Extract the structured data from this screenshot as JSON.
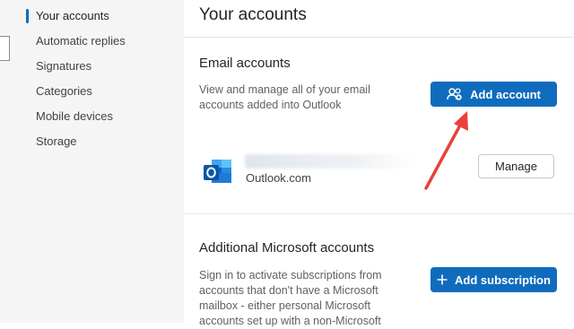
{
  "nav": {
    "items": [
      {
        "label": "Your accounts",
        "active": true
      },
      {
        "label": "Automatic replies",
        "active": false
      },
      {
        "label": "Signatures",
        "active": false
      },
      {
        "label": "Categories",
        "active": false
      },
      {
        "label": "Mobile devices",
        "active": false
      },
      {
        "label": "Storage",
        "active": false
      }
    ]
  },
  "main": {
    "title": "Your accounts",
    "email_accounts": {
      "heading": "Email accounts",
      "description_line1": "View and manage all of your email",
      "description_line2": "accounts added into Outlook",
      "add_button_label": "Add account",
      "add_button_icon": "add-person-icon",
      "account": {
        "icon": "outlook-logo-icon",
        "domain": "Outlook.com",
        "manage_label": "Manage"
      }
    },
    "additional_accounts": {
      "heading": "Additional Microsoft accounts",
      "description_line1": "Sign in to activate subscriptions from",
      "description_line2": "accounts that don't have a Microsoft",
      "description_line3": "mailbox - either personal Microsoft",
      "description_line4": "accounts set up with a non-Microsoft",
      "add_button_label": "Add subscription",
      "add_button_icon": "plus-icon"
    }
  },
  "colors": {
    "accent": "#0f6cbd",
    "annotation_arrow": "#e8413a",
    "nav_background": "#f5f5f5"
  }
}
